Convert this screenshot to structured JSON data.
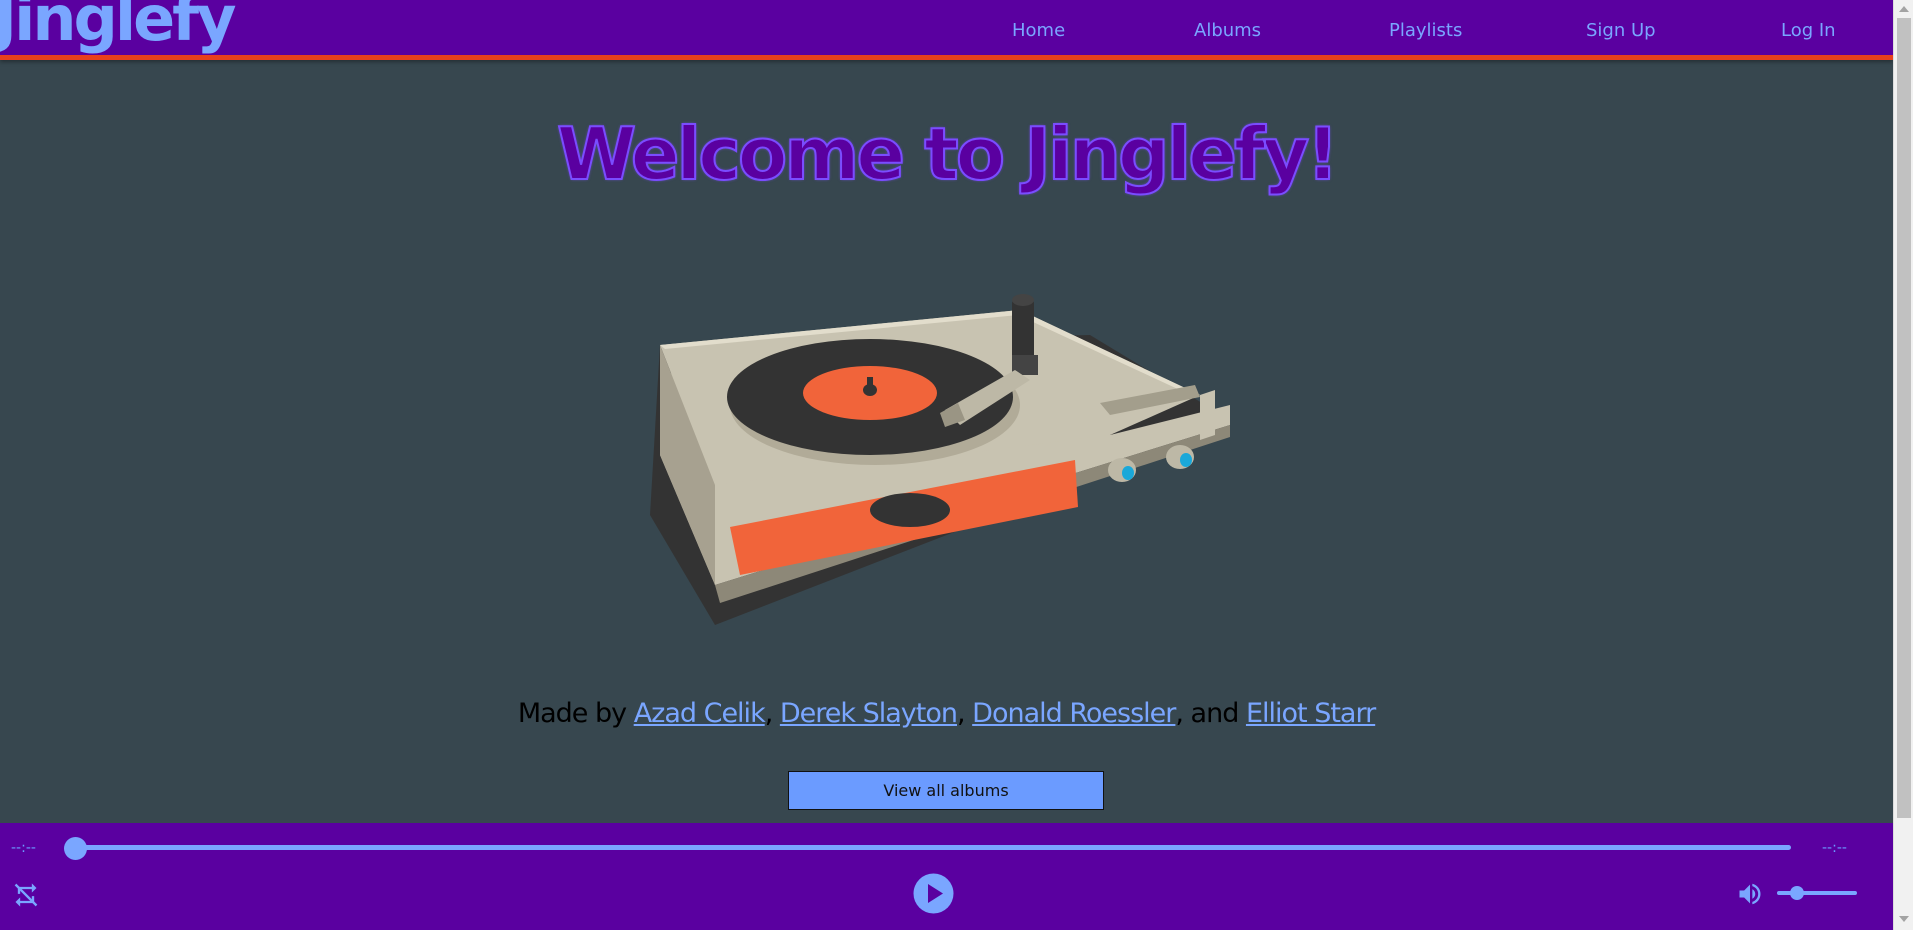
{
  "nav": {
    "logo": "Jinglefy",
    "links": [
      "Home",
      "Albums",
      "Playlists",
      "Sign Up",
      "Log In"
    ]
  },
  "main": {
    "title": "Welcome to Jinglefy!",
    "credits": {
      "prefix": "Made by ",
      "authors": [
        "Azad Celik",
        "Derek Slayton",
        "Donald Roessler",
        "Elliot Starr"
      ],
      "sep1": ", ",
      "sep2": ", ",
      "sep3": ", and "
    },
    "view_button": "View all albums",
    "image_alt": "turntable"
  },
  "player": {
    "current_time": "--:--",
    "total_time": "--:--",
    "progress": 0,
    "volume": 0.25,
    "icons": [
      "repeat-off-icon",
      "play-icon",
      "volume-icon"
    ]
  },
  "colors": {
    "nav_bg": "#5a00a0",
    "accent": "#7aa6ff",
    "page_bg": "#37474f",
    "nav_border": "#e8401c",
    "button_bg": "#6b9bff"
  }
}
